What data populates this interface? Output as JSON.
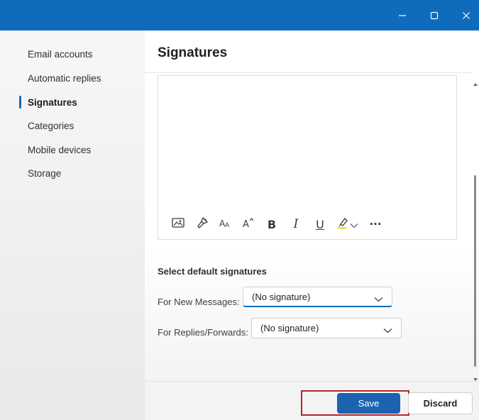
{
  "window": {
    "minimize_icon": "minimize-icon",
    "maximize_icon": "maximize-icon",
    "close_icon": "close-icon",
    "titlebar_color": "#0f6cbd"
  },
  "sidebar": {
    "items": [
      {
        "label": "Email accounts",
        "active": false
      },
      {
        "label": "Automatic replies",
        "active": false
      },
      {
        "label": "Signatures",
        "active": true
      },
      {
        "label": "Categories",
        "active": false
      },
      {
        "label": "Mobile devices",
        "active": false
      },
      {
        "label": "Storage",
        "active": false
      }
    ],
    "accent": "#0f6cbd"
  },
  "main": {
    "title": "Signatures",
    "editor": {
      "value": "",
      "toolbar": [
        {
          "name": "insert-picture-icon"
        },
        {
          "name": "format-painter-icon"
        },
        {
          "name": "font-size-icon"
        },
        {
          "name": "font-grow-icon"
        },
        {
          "name": "bold-icon",
          "glyph": "B"
        },
        {
          "name": "italic-icon",
          "glyph": "I"
        },
        {
          "name": "underline-icon",
          "glyph": "U"
        },
        {
          "name": "highlighter-icon"
        },
        {
          "name": "chevron-down-icon"
        },
        {
          "name": "more-options-icon",
          "glyph": "···"
        }
      ]
    },
    "defaults": {
      "section_label": "Select default signatures",
      "new_messages_label": "For New Messages:",
      "new_messages_value": "(No signature)",
      "replies_label": "For Replies/Forwards:",
      "replies_value": "(No signature)"
    }
  },
  "footer": {
    "save_label": "Save",
    "discard_label": "Discard",
    "save_color": "#1b63b0",
    "highlight_color": "#b3262f"
  }
}
